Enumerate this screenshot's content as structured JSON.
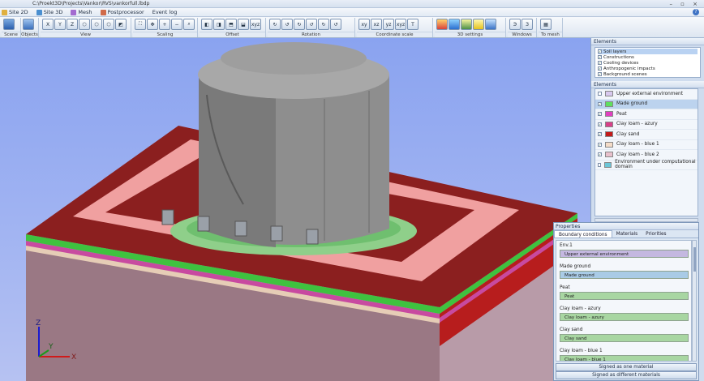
{
  "window": {
    "title_path": "C:\\Proekt3D\\Projects\\Vankor\\RVS\\vankorfull.lbdp",
    "controls": "– ▫ ×"
  },
  "menu": [
    {
      "label": "Site 2D",
      "color": "#e0b040"
    },
    {
      "label": "Site 3D",
      "color": "#4a8fd0"
    },
    {
      "label": "Mesh",
      "color": "#a36ad0"
    },
    {
      "label": "Postprocessor",
      "color": "#d06a4a"
    },
    {
      "label": "Event log",
      "color": ""
    }
  ],
  "help_icon": "?",
  "ribbon_groups": [
    {
      "label": "Scene",
      "icons": [
        "scene-icon"
      ]
    },
    {
      "label": "Objects",
      "icons": [
        "objects-icon"
      ]
    },
    {
      "label": "View",
      "icons": [
        "view-x",
        "view-y",
        "view-z",
        "view-iso1",
        "view-iso2",
        "view-iso3",
        "view-persp"
      ]
    },
    {
      "label": "Scaling",
      "icons": [
        "fit",
        "pan",
        "zoom-in",
        "zoom-out",
        "zoom-sel"
      ]
    },
    {
      "label": "Offset",
      "icons": [
        "move-l",
        "move-r",
        "move-u",
        "move-d",
        "move-xyz"
      ]
    },
    {
      "label": "Rotation",
      "icons": [
        "rot-1",
        "rot-2",
        "rot-3",
        "rot-4",
        "rot-5",
        "rot-6"
      ]
    },
    {
      "label": "Coordinate scale",
      "icons": [
        "xy",
        "xz",
        "yz",
        "xyz",
        "text"
      ]
    },
    {
      "label": "3D settings",
      "icons": [
        "palette",
        "layers",
        "light",
        "bulb",
        "cube"
      ]
    },
    {
      "label": "Windows",
      "icons": [
        "win-e",
        "win-3"
      ]
    },
    {
      "label": "To mesh",
      "icons": [
        "grid"
      ]
    }
  ],
  "elements_top": {
    "title": "Elements",
    "layers": [
      {
        "label": "Soil layers",
        "checked": true,
        "selected": true
      },
      {
        "label": "Constructions",
        "checked": true,
        "selected": false
      },
      {
        "label": "Cooling devices",
        "checked": true,
        "selected": false
      },
      {
        "label": "Anthropogenic impacts",
        "checked": true,
        "selected": false
      },
      {
        "label": "Background scenes",
        "checked": true,
        "selected": false
      }
    ]
  },
  "elements_list": {
    "title": "Elements",
    "items": [
      {
        "label": "Upper external environment",
        "color": "#d8c8ee",
        "checked": false,
        "selected": false
      },
      {
        "label": "Made ground",
        "color": "#5fe05f",
        "checked": true,
        "selected": true
      },
      {
        "label": "Peat",
        "color": "#e040c0",
        "checked": true,
        "selected": false
      },
      {
        "label": "Clay loam - azury",
        "color": "#d8408a",
        "checked": true,
        "selected": false
      },
      {
        "label": "Clay sand",
        "color": "#c41a1a",
        "checked": true,
        "selected": false
      },
      {
        "label": "Clay loam - blue 1",
        "color": "#f4dcc8",
        "checked": true,
        "selected": false
      },
      {
        "label": "Clay loam - blue 2",
        "color": "#e8c0cc",
        "checked": true,
        "selected": false
      },
      {
        "label": "Environment under computational domain",
        "color": "#6cc6d8",
        "checked": false,
        "selected": false
      }
    ]
  },
  "properties": {
    "title": "Properties",
    "tabs": [
      "Boundary conditions",
      "Materials",
      "Priorities"
    ],
    "entries": [
      {
        "name": "Env.1",
        "value": "Upper external environment",
        "color": "#c4b8e0"
      },
      {
        "name": "Made ground",
        "value": "Made ground",
        "color": "#a9cbe6"
      },
      {
        "name": "Peat",
        "value": "Peat",
        "color": "#a8d6a2"
      },
      {
        "name": "Clay loam - azury",
        "value": "Clay loam - azury",
        "color": "#a8d6a2"
      },
      {
        "name": "Clay sand",
        "value": "Clay sand",
        "color": "#a8d6a2"
      },
      {
        "name": "Clay loam - blue 1",
        "value": "Clay loam - blue 1",
        "color": "#a8d6a2"
      }
    ],
    "btn_one": "Signed as one material",
    "btn_diff": "Signed as different materials"
  },
  "axes": {
    "x": "X",
    "y": "Y",
    "z": "Z"
  }
}
